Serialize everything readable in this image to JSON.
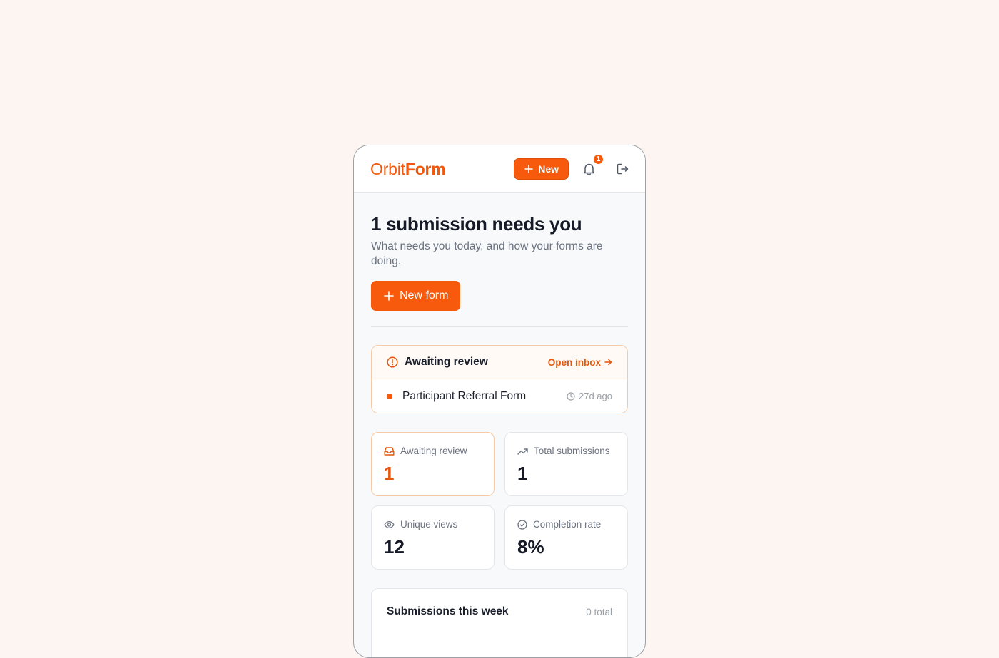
{
  "brand": {
    "logo_light": "Orbit",
    "logo_bold": "Form"
  },
  "header": {
    "new_label": "New",
    "notification_count": "1"
  },
  "hero": {
    "title": "1 submission needs you",
    "subtitle": "What needs you today, and how your forms are doing.",
    "new_form_label": "New form"
  },
  "review": {
    "title": "Awaiting review",
    "open_inbox_label": "Open inbox",
    "items": [
      {
        "name": "Participant Referral Form",
        "time": "27d ago"
      }
    ]
  },
  "stats": [
    {
      "label": "Awaiting review",
      "value": "1",
      "icon": "inbox-icon"
    },
    {
      "label": "Total submissions",
      "value": "1",
      "icon": "trending-up-icon"
    },
    {
      "label": "Unique views",
      "value": "12",
      "icon": "eye-icon"
    },
    {
      "label": "Completion rate",
      "value": "8%",
      "icon": "check-circle-icon"
    }
  ],
  "week": {
    "title": "Submissions this week",
    "total": "0 total"
  },
  "colors": {
    "accent": "#f75a0c",
    "accent_text": "#e4570f",
    "background": "#fdf5f1"
  }
}
